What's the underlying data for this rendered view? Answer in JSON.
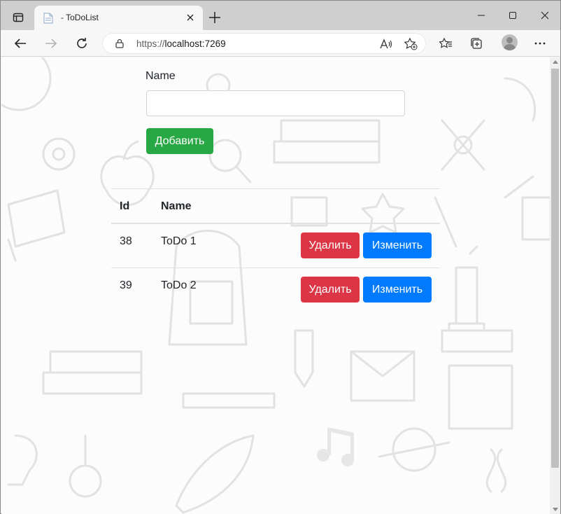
{
  "browser": {
    "tab_title": "- ToDoList",
    "url_prefix": "https://",
    "url_host": "localhost:7269"
  },
  "form": {
    "name_label": "Name",
    "name_value": "",
    "add_button": "Добавить"
  },
  "table": {
    "headers": [
      "Id",
      "Name"
    ],
    "rows": [
      {
        "id": "38",
        "name": "ToDo 1",
        "delete_label": "Удалить",
        "edit_label": "Изменить"
      },
      {
        "id": "39",
        "name": "ToDo 2",
        "delete_label": "Удалить",
        "edit_label": "Изменить"
      }
    ]
  },
  "colors": {
    "add": "#28a745",
    "delete": "#dc3545",
    "edit": "#007bff"
  }
}
